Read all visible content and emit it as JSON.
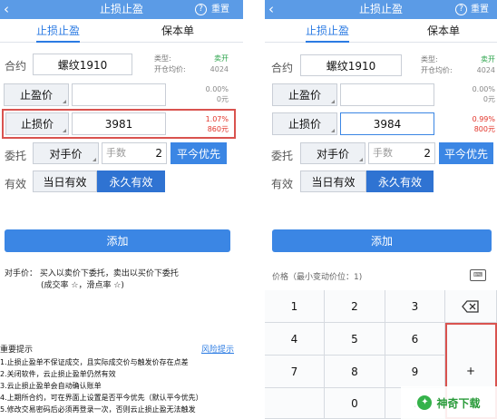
{
  "left": {
    "title": "止损止盈",
    "reset": "重置",
    "tabs": [
      "止损止盈",
      "保本单"
    ],
    "contract_label": "合约",
    "contract_value": "螺纹1910",
    "type_label": "类型:",
    "type_value": "卖开",
    "open_avg_label": "开仓均价:",
    "open_avg_value": "4024",
    "take_profit_label": "止盈价",
    "take_profit_value": "",
    "take_profit_pct": "0.00%",
    "take_profit_amt": "0元",
    "stop_loss_label": "止损价",
    "stop_loss_value": "3981",
    "stop_loss_pct": "1.07%",
    "stop_loss_amt": "860元",
    "entrust_label": "委托",
    "entrust_price": "对手价",
    "qty_placeholder": "手数",
    "qty_value": "2",
    "close_priority": "平今优先",
    "valid_label": "有效",
    "valid_today": "当日有效",
    "valid_forever": "永久有效",
    "add_button": "添加",
    "note_line1": "对手价：  买入以卖价下委托，卖出以买价下委托",
    "note_line2": "(成交率 ☆，滑点率 ☆)",
    "warning_title": "重要提示",
    "risk_link": "风险提示",
    "rules": [
      "1.止损止盈单不保证成交，且实际成交价与触发价存在点差",
      "2.关闭软件，云止损止盈单仍然有效",
      "3.云止损止盈单会自动确认账单",
      "4.上期所合约，可在界面上设置是否平今优先（默认平今优先）",
      "5.修改交易密码后必须再登录一次，否则云止损止盈无法触发"
    ]
  },
  "right": {
    "title": "止损止盈",
    "reset": "重置",
    "tabs": [
      "止损止盈",
      "保本单"
    ],
    "contract_label": "合约",
    "contract_value": "螺纹1910",
    "type_label": "类型:",
    "type_value": "卖开",
    "open_avg_label": "开仓均价:",
    "open_avg_value": "4024",
    "take_profit_label": "止盈价",
    "take_profit_value": "",
    "take_profit_pct": "0.00%",
    "take_profit_amt": "0元",
    "stop_loss_label": "止损价",
    "stop_loss_value": "3984",
    "stop_loss_pct": "0.99%",
    "stop_loss_amt": "800元",
    "entrust_label": "委托",
    "entrust_price": "对手价",
    "qty_placeholder": "手数",
    "qty_value": "2",
    "close_priority": "平今优先",
    "valid_label": "有效",
    "valid_today": "当日有效",
    "valid_forever": "永久有效",
    "add_button": "添加",
    "keypad_hint": "价格（最小变动价位：1)",
    "keys": [
      "1",
      "2",
      "3",
      "4",
      "5",
      "6",
      "7",
      "8",
      "9",
      "",
      "0",
      "."
    ],
    "plus_key": "+"
  },
  "watermark": "神奇下载",
  "colors": {
    "nav": "#5b9be6",
    "accent": "#3b86e4",
    "loss_red": "#e2342a",
    "frame_red": "#d9534f"
  }
}
